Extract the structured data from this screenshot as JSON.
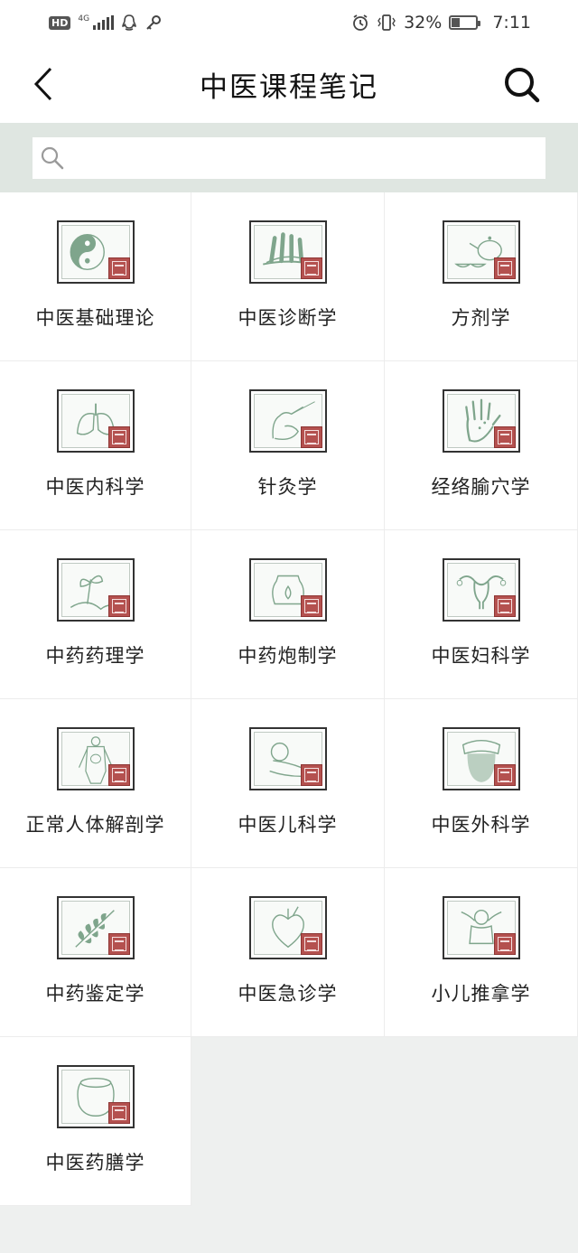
{
  "status_bar": {
    "hd": "HD",
    "network": "4G",
    "battery_percent": "32%",
    "battery_level": 0.32,
    "time": "7:11",
    "icons": [
      "hd-icon",
      "signal-icon",
      "qq-icon",
      "key-icon",
      "alarm-icon",
      "vibrate-icon",
      "battery-icon"
    ]
  },
  "header": {
    "title": "中医课程笔记",
    "back_icon": "chevron-left-icon",
    "search_icon": "search-icon"
  },
  "search": {
    "placeholder": "",
    "value": ""
  },
  "courses": [
    {
      "label": "中医基础理论",
      "icon": "yin-yang-icon"
    },
    {
      "label": "中医诊断学",
      "icon": "pulse-diagnosis-icon"
    },
    {
      "label": "方剂学",
      "icon": "teapot-icon"
    },
    {
      "label": "中医内科学",
      "icon": "lungs-icon"
    },
    {
      "label": "针灸学",
      "icon": "acupuncture-hand-icon"
    },
    {
      "label": "经络腧穴学",
      "icon": "palm-meridian-icon"
    },
    {
      "label": "中药药理学",
      "icon": "herb-sprout-icon"
    },
    {
      "label": "中药炮制学",
      "icon": "medicine-jar-icon"
    },
    {
      "label": "中医妇科学",
      "icon": "uterus-icon"
    },
    {
      "label": "正常人体解剖学",
      "icon": "anatomy-body-icon"
    },
    {
      "label": "中医儿科学",
      "icon": "baby-icon"
    },
    {
      "label": "中医外科学",
      "icon": "tongue-icon"
    },
    {
      "label": "中药鉴定学",
      "icon": "leaf-branch-icon"
    },
    {
      "label": "中医急诊学",
      "icon": "heart-icon"
    },
    {
      "label": "小儿推拿学",
      "icon": "child-massage-icon"
    },
    {
      "label": "中医药膳学",
      "icon": "food-pot-icon"
    }
  ],
  "colors": {
    "band": "#dfe6e1",
    "background": "#eef0ef",
    "seal": "#b4514f",
    "illustration": "#7fa58c"
  }
}
